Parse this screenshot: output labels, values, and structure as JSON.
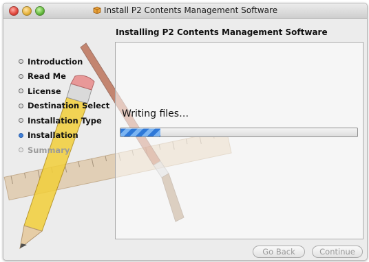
{
  "window": {
    "title": "Install P2 Contents Management Software"
  },
  "header": {
    "subtitle": "Installing P2 Contents Management Software"
  },
  "sidebar": {
    "steps": [
      {
        "label": "Introduction",
        "state": "done"
      },
      {
        "label": "Read Me",
        "state": "done"
      },
      {
        "label": "License",
        "state": "done"
      },
      {
        "label": "Destination Select",
        "state": "done"
      },
      {
        "label": "Installation Type",
        "state": "done"
      },
      {
        "label": "Installation",
        "state": "active"
      },
      {
        "label": "Summary",
        "state": "pending"
      }
    ]
  },
  "main": {
    "status": "Writing files…",
    "progress": 0.17
  },
  "buttons": {
    "back": "Go Back",
    "continue": "Continue"
  },
  "colors": {
    "active_bullet": "#3f7fd8",
    "progress_fill": "#2e78d8"
  }
}
